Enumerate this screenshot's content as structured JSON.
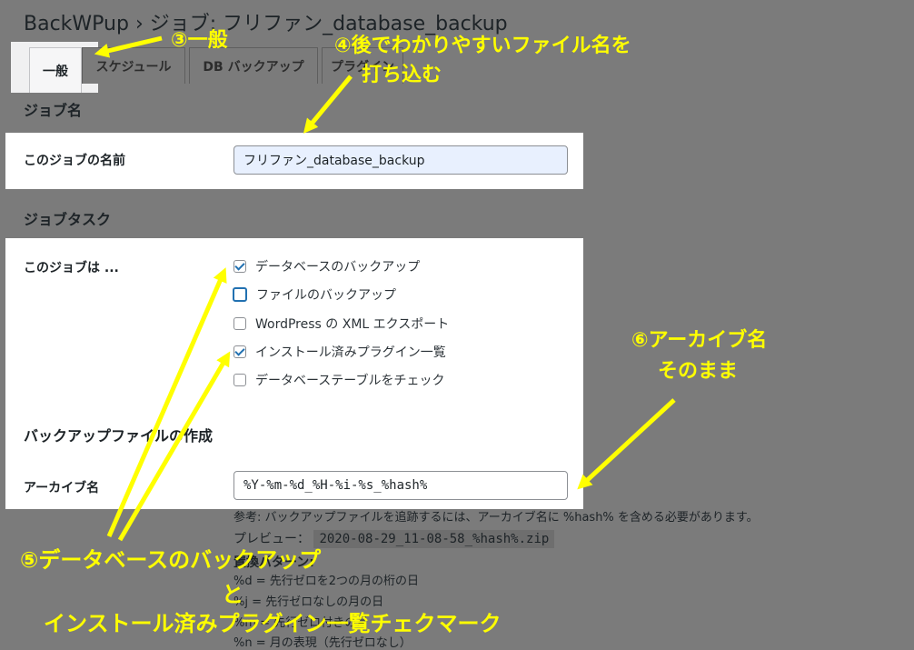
{
  "header": {
    "title": "BackWPup › ジョブ: フリファン_database_backup"
  },
  "tabs": [
    {
      "label": "一般",
      "active": true
    },
    {
      "label": "スケジュール",
      "active": false
    },
    {
      "label": "DB バックアップ",
      "active": false
    },
    {
      "label": "プラグイン",
      "active": false
    }
  ],
  "job_name_section": {
    "title": "ジョブ名",
    "field_label": "このジョブの名前",
    "field_value": "フリファン_database_backup"
  },
  "job_tasks_section": {
    "title": "ジョブタスク",
    "field_label": "このジョブは ...",
    "tasks": [
      {
        "label": "データベースのバックアップ",
        "checked": true
      },
      {
        "label": "ファイルのバックアップ",
        "checked": false
      },
      {
        "label": "WordPress の XML エクスポート",
        "checked": false
      },
      {
        "label": "インストール済みプラグイン一覧",
        "checked": true
      },
      {
        "label": "データベーステーブルをチェック",
        "checked": false
      }
    ]
  },
  "backup_file_section": {
    "title": "バックアップファイルの作成",
    "archive_label": "アーカイブ名",
    "archive_value": "%Y-%m-%d_%H-%i-%s_%hash%",
    "note": "参考: バックアップファイルを追跡するには、アーカイブ名に %hash% を含める必要があります。",
    "preview_label": "プレビュー：",
    "preview_value": "2020-08-29_11-08-58_%hash%.zip",
    "replacement_heading": "置換パターン:",
    "patterns": [
      "%d = 先行ゼロを2つの月の桁の日",
      "%j = 先行ゼロなしの月の日",
      "%m = 先行ゼロ付きの月",
      "%n = 月の表現（先行ゼロなし）"
    ]
  },
  "annotations": {
    "step3": "③一般",
    "step4_line1": "④後でわかりやすいファイル名を",
    "step4_line2": "打ち込む",
    "step5_line1": "⑤データベースのバックアップ",
    "step5_line2": "と",
    "step5_line3": "インストール済みプラグイン一覧チェクマーク",
    "step6_line1": "⑥アーカイブ名",
    "step6_line2": "そのまま"
  },
  "colors": {
    "overlay_gray": "#7b7b7b",
    "annotation_yellow": "#ffff00",
    "checkbox_blue": "#2271b1"
  }
}
